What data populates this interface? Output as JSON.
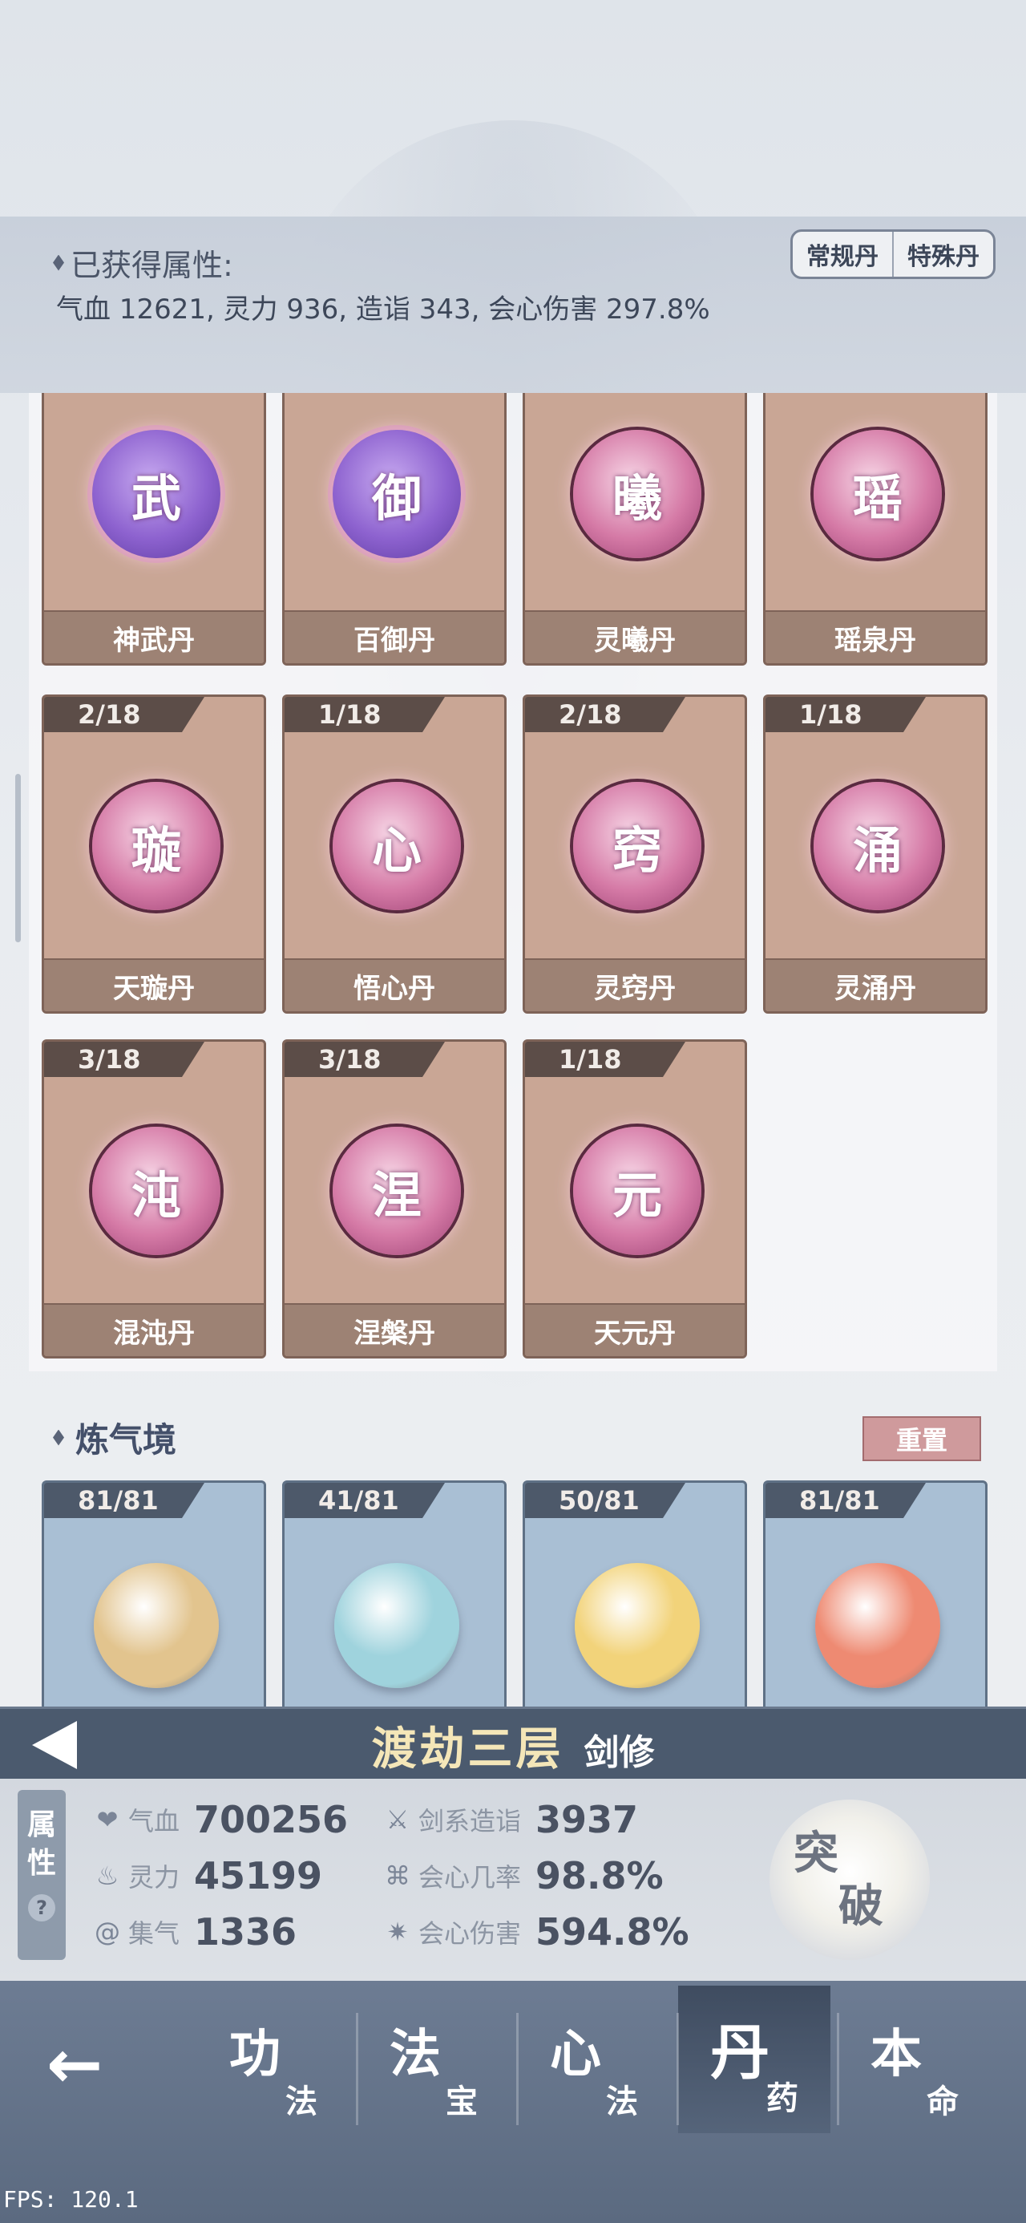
{
  "header": {
    "title": "已获得属性:",
    "summary": "气血 12621, 灵力 936, 造诣 343, 会心伤害 297.8%",
    "tabs": [
      "常规丹",
      "特殊丹"
    ]
  },
  "pills": [
    {
      "name": "神武丹",
      "glyph": "武",
      "count": "",
      "style": "purple"
    },
    {
      "name": "百御丹",
      "glyph": "御",
      "count": "",
      "style": "purple"
    },
    {
      "name": "灵曦丹",
      "glyph": "曦",
      "count": "",
      "style": "pink"
    },
    {
      "name": "瑶泉丹",
      "glyph": "瑶",
      "count": "",
      "style": "pink"
    },
    {
      "name": "天璇丹",
      "glyph": "璇",
      "count": "2/18",
      "style": "pink"
    },
    {
      "name": "悟心丹",
      "glyph": "心",
      "count": "1/18",
      "style": "pink"
    },
    {
      "name": "灵窍丹",
      "glyph": "窍",
      "count": "2/18",
      "style": "pink"
    },
    {
      "name": "灵涌丹",
      "glyph": "涌",
      "count": "1/18",
      "style": "pink"
    },
    {
      "name": "混沌丹",
      "glyph": "沌",
      "count": "3/18",
      "style": "pink"
    },
    {
      "name": "涅槃丹",
      "glyph": "涅",
      "count": "3/18",
      "style": "pink"
    },
    {
      "name": "天元丹",
      "glyph": "元",
      "count": "1/18",
      "style": "pink"
    }
  ],
  "section2": {
    "title": "炼气境",
    "reset_label": "重置",
    "items": [
      {
        "count": "81/81",
        "color": "#e2c48e"
      },
      {
        "count": "41/81",
        "color": "#9fd3dd"
      },
      {
        "count": "50/81",
        "color": "#f2d37a"
      },
      {
        "count": "81/81",
        "color": "#ee8a72"
      }
    ]
  },
  "realm": {
    "name": "渡劫三层",
    "class": "剑修"
  },
  "stats_tab": {
    "label_top": "属",
    "label_bottom": "性",
    "help": "?"
  },
  "stats": [
    {
      "label": "气血",
      "value": "700256",
      "icon": "heart-icon"
    },
    {
      "label": "灵力",
      "value": "45199",
      "icon": "flame-icon"
    },
    {
      "label": "集气",
      "value": "1336",
      "icon": "swirl-icon"
    },
    {
      "label": "剑系造诣",
      "value": "3937",
      "icon": "sword-icon"
    },
    {
      "label": "会心几率",
      "value": "98.8%",
      "icon": "knot-icon"
    },
    {
      "label": "会心伤害",
      "value": "594.8%",
      "icon": "burst-icon"
    }
  ],
  "breakthrough": {
    "line1": "突",
    "line2": "破"
  },
  "nav": {
    "tabs": [
      {
        "big": "功",
        "small": "法",
        "active": false
      },
      {
        "big": "法",
        "small": "宝",
        "active": false
      },
      {
        "big": "心",
        "small": "法",
        "active": false
      },
      {
        "big": "丹",
        "small": "药",
        "active": true
      },
      {
        "big": "本",
        "small": "命",
        "active": false
      }
    ]
  },
  "fps": "FPS: 120.1"
}
